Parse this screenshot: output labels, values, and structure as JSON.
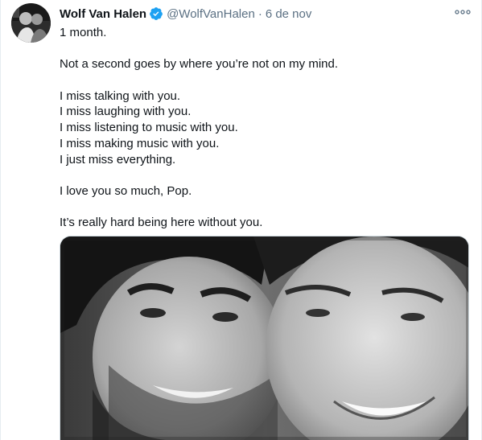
{
  "tweet": {
    "author_name": "Wolf Van Halen",
    "handle": "@WolfVanHalen",
    "separator": "·",
    "date": "6 de nov",
    "lines": [
      "1 month.",
      "",
      "Not a second goes by where you’re not on my mind.",
      "",
      "I miss talking with you.",
      "I miss laughing with you.",
      "I miss listening to music with you.",
      "I miss making music with you.",
      "I just miss everything.",
      "",
      "I love you so much, Pop.",
      "",
      "It’s really hard being here without you."
    ]
  },
  "icons": {
    "verified": "verified-badge-icon",
    "more": "more-options-icon"
  },
  "colors": {
    "verified_blue": "#1da1f2",
    "secondary_text": "#5b7083",
    "primary_text": "#0f1419",
    "border": "#e6ecf0"
  }
}
